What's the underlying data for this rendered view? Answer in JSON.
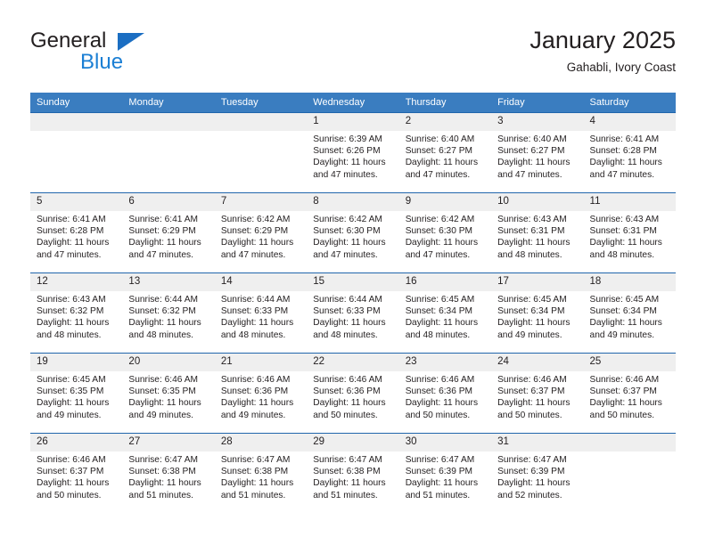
{
  "brand": {
    "name_top": "General",
    "name_bottom": "Blue",
    "accent_color": "#1b7fd4",
    "triangle_color": "#1b6ec2"
  },
  "header": {
    "title": "January 2025",
    "subtitle": "Gahabli, Ivory Coast"
  },
  "theme": {
    "header_row_bg": "#3a7dc0",
    "header_row_text": "#ffffff",
    "cell_top_border": "#2166ac",
    "daynum_bg": "#efefef",
    "text": "#231f20"
  },
  "calendar": {
    "weekday_headers": [
      "Sunday",
      "Monday",
      "Tuesday",
      "Wednesday",
      "Thursday",
      "Friday",
      "Saturday"
    ],
    "weeks": [
      [
        {
          "day": "",
          "sunrise": "",
          "sunset": "",
          "daylight_line1": "",
          "daylight_line2": ""
        },
        {
          "day": "",
          "sunrise": "",
          "sunset": "",
          "daylight_line1": "",
          "daylight_line2": ""
        },
        {
          "day": "",
          "sunrise": "",
          "sunset": "",
          "daylight_line1": "",
          "daylight_line2": ""
        },
        {
          "day": "1",
          "sunrise": "Sunrise: 6:39 AM",
          "sunset": "Sunset: 6:26 PM",
          "daylight_line1": "Daylight: 11 hours",
          "daylight_line2": "and 47 minutes."
        },
        {
          "day": "2",
          "sunrise": "Sunrise: 6:40 AM",
          "sunset": "Sunset: 6:27 PM",
          "daylight_line1": "Daylight: 11 hours",
          "daylight_line2": "and 47 minutes."
        },
        {
          "day": "3",
          "sunrise": "Sunrise: 6:40 AM",
          "sunset": "Sunset: 6:27 PM",
          "daylight_line1": "Daylight: 11 hours",
          "daylight_line2": "and 47 minutes."
        },
        {
          "day": "4",
          "sunrise": "Sunrise: 6:41 AM",
          "sunset": "Sunset: 6:28 PM",
          "daylight_line1": "Daylight: 11 hours",
          "daylight_line2": "and 47 minutes."
        }
      ],
      [
        {
          "day": "5",
          "sunrise": "Sunrise: 6:41 AM",
          "sunset": "Sunset: 6:28 PM",
          "daylight_line1": "Daylight: 11 hours",
          "daylight_line2": "and 47 minutes."
        },
        {
          "day": "6",
          "sunrise": "Sunrise: 6:41 AM",
          "sunset": "Sunset: 6:29 PM",
          "daylight_line1": "Daylight: 11 hours",
          "daylight_line2": "and 47 minutes."
        },
        {
          "day": "7",
          "sunrise": "Sunrise: 6:42 AM",
          "sunset": "Sunset: 6:29 PM",
          "daylight_line1": "Daylight: 11 hours",
          "daylight_line2": "and 47 minutes."
        },
        {
          "day": "8",
          "sunrise": "Sunrise: 6:42 AM",
          "sunset": "Sunset: 6:30 PM",
          "daylight_line1": "Daylight: 11 hours",
          "daylight_line2": "and 47 minutes."
        },
        {
          "day": "9",
          "sunrise": "Sunrise: 6:42 AM",
          "sunset": "Sunset: 6:30 PM",
          "daylight_line1": "Daylight: 11 hours",
          "daylight_line2": "and 47 minutes."
        },
        {
          "day": "10",
          "sunrise": "Sunrise: 6:43 AM",
          "sunset": "Sunset: 6:31 PM",
          "daylight_line1": "Daylight: 11 hours",
          "daylight_line2": "and 48 minutes."
        },
        {
          "day": "11",
          "sunrise": "Sunrise: 6:43 AM",
          "sunset": "Sunset: 6:31 PM",
          "daylight_line1": "Daylight: 11 hours",
          "daylight_line2": "and 48 minutes."
        }
      ],
      [
        {
          "day": "12",
          "sunrise": "Sunrise: 6:43 AM",
          "sunset": "Sunset: 6:32 PM",
          "daylight_line1": "Daylight: 11 hours",
          "daylight_line2": "and 48 minutes."
        },
        {
          "day": "13",
          "sunrise": "Sunrise: 6:44 AM",
          "sunset": "Sunset: 6:32 PM",
          "daylight_line1": "Daylight: 11 hours",
          "daylight_line2": "and 48 minutes."
        },
        {
          "day": "14",
          "sunrise": "Sunrise: 6:44 AM",
          "sunset": "Sunset: 6:33 PM",
          "daylight_line1": "Daylight: 11 hours",
          "daylight_line2": "and 48 minutes."
        },
        {
          "day": "15",
          "sunrise": "Sunrise: 6:44 AM",
          "sunset": "Sunset: 6:33 PM",
          "daylight_line1": "Daylight: 11 hours",
          "daylight_line2": "and 48 minutes."
        },
        {
          "day": "16",
          "sunrise": "Sunrise: 6:45 AM",
          "sunset": "Sunset: 6:34 PM",
          "daylight_line1": "Daylight: 11 hours",
          "daylight_line2": "and 48 minutes."
        },
        {
          "day": "17",
          "sunrise": "Sunrise: 6:45 AM",
          "sunset": "Sunset: 6:34 PM",
          "daylight_line1": "Daylight: 11 hours",
          "daylight_line2": "and 49 minutes."
        },
        {
          "day": "18",
          "sunrise": "Sunrise: 6:45 AM",
          "sunset": "Sunset: 6:34 PM",
          "daylight_line1": "Daylight: 11 hours",
          "daylight_line2": "and 49 minutes."
        }
      ],
      [
        {
          "day": "19",
          "sunrise": "Sunrise: 6:45 AM",
          "sunset": "Sunset: 6:35 PM",
          "daylight_line1": "Daylight: 11 hours",
          "daylight_line2": "and 49 minutes."
        },
        {
          "day": "20",
          "sunrise": "Sunrise: 6:46 AM",
          "sunset": "Sunset: 6:35 PM",
          "daylight_line1": "Daylight: 11 hours",
          "daylight_line2": "and 49 minutes."
        },
        {
          "day": "21",
          "sunrise": "Sunrise: 6:46 AM",
          "sunset": "Sunset: 6:36 PM",
          "daylight_line1": "Daylight: 11 hours",
          "daylight_line2": "and 49 minutes."
        },
        {
          "day": "22",
          "sunrise": "Sunrise: 6:46 AM",
          "sunset": "Sunset: 6:36 PM",
          "daylight_line1": "Daylight: 11 hours",
          "daylight_line2": "and 50 minutes."
        },
        {
          "day": "23",
          "sunrise": "Sunrise: 6:46 AM",
          "sunset": "Sunset: 6:36 PM",
          "daylight_line1": "Daylight: 11 hours",
          "daylight_line2": "and 50 minutes."
        },
        {
          "day": "24",
          "sunrise": "Sunrise: 6:46 AM",
          "sunset": "Sunset: 6:37 PM",
          "daylight_line1": "Daylight: 11 hours",
          "daylight_line2": "and 50 minutes."
        },
        {
          "day": "25",
          "sunrise": "Sunrise: 6:46 AM",
          "sunset": "Sunset: 6:37 PM",
          "daylight_line1": "Daylight: 11 hours",
          "daylight_line2": "and 50 minutes."
        }
      ],
      [
        {
          "day": "26",
          "sunrise": "Sunrise: 6:46 AM",
          "sunset": "Sunset: 6:37 PM",
          "daylight_line1": "Daylight: 11 hours",
          "daylight_line2": "and 50 minutes."
        },
        {
          "day": "27",
          "sunrise": "Sunrise: 6:47 AM",
          "sunset": "Sunset: 6:38 PM",
          "daylight_line1": "Daylight: 11 hours",
          "daylight_line2": "and 51 minutes."
        },
        {
          "day": "28",
          "sunrise": "Sunrise: 6:47 AM",
          "sunset": "Sunset: 6:38 PM",
          "daylight_line1": "Daylight: 11 hours",
          "daylight_line2": "and 51 minutes."
        },
        {
          "day": "29",
          "sunrise": "Sunrise: 6:47 AM",
          "sunset": "Sunset: 6:38 PM",
          "daylight_line1": "Daylight: 11 hours",
          "daylight_line2": "and 51 minutes."
        },
        {
          "day": "30",
          "sunrise": "Sunrise: 6:47 AM",
          "sunset": "Sunset: 6:39 PM",
          "daylight_line1": "Daylight: 11 hours",
          "daylight_line2": "and 51 minutes."
        },
        {
          "day": "31",
          "sunrise": "Sunrise: 6:47 AM",
          "sunset": "Sunset: 6:39 PM",
          "daylight_line1": "Daylight: 11 hours",
          "daylight_line2": "and 52 minutes."
        },
        {
          "day": "",
          "sunrise": "",
          "sunset": "",
          "daylight_line1": "",
          "daylight_line2": ""
        }
      ]
    ]
  }
}
